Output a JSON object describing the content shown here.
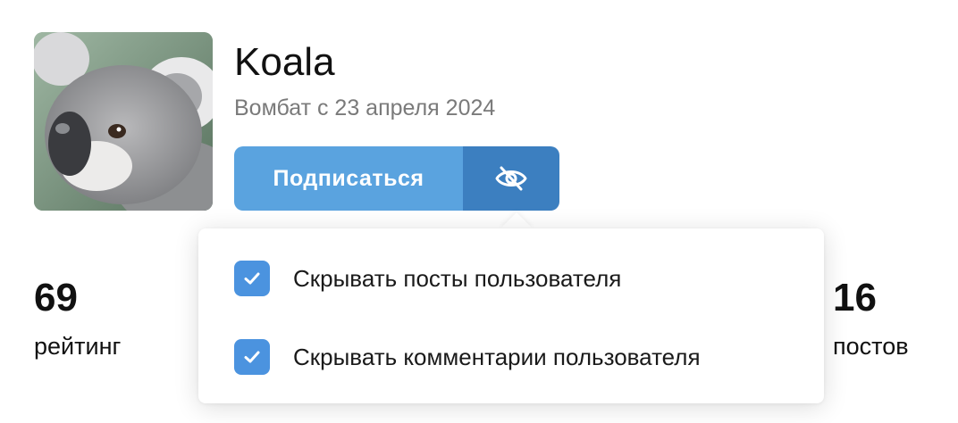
{
  "profile": {
    "name": "Koala",
    "since": "Вомбат с 23 апреля 2024"
  },
  "actions": {
    "subscribe_label": "Подписаться",
    "hide_icon": "eye-slash-icon"
  },
  "stats": {
    "rating": {
      "value": "69",
      "label": "рейтинг"
    },
    "posts": {
      "value": "16",
      "label": "постов"
    }
  },
  "hide_menu": {
    "options": [
      {
        "label": "Скрывать посты пользователя",
        "checked": true
      },
      {
        "label": "Скрывать комментарии пользователя",
        "checked": true
      }
    ]
  },
  "colors": {
    "subscribe_button": "#5aa3df",
    "hide_button": "#3c7fc0",
    "checkbox": "#4b93df"
  }
}
